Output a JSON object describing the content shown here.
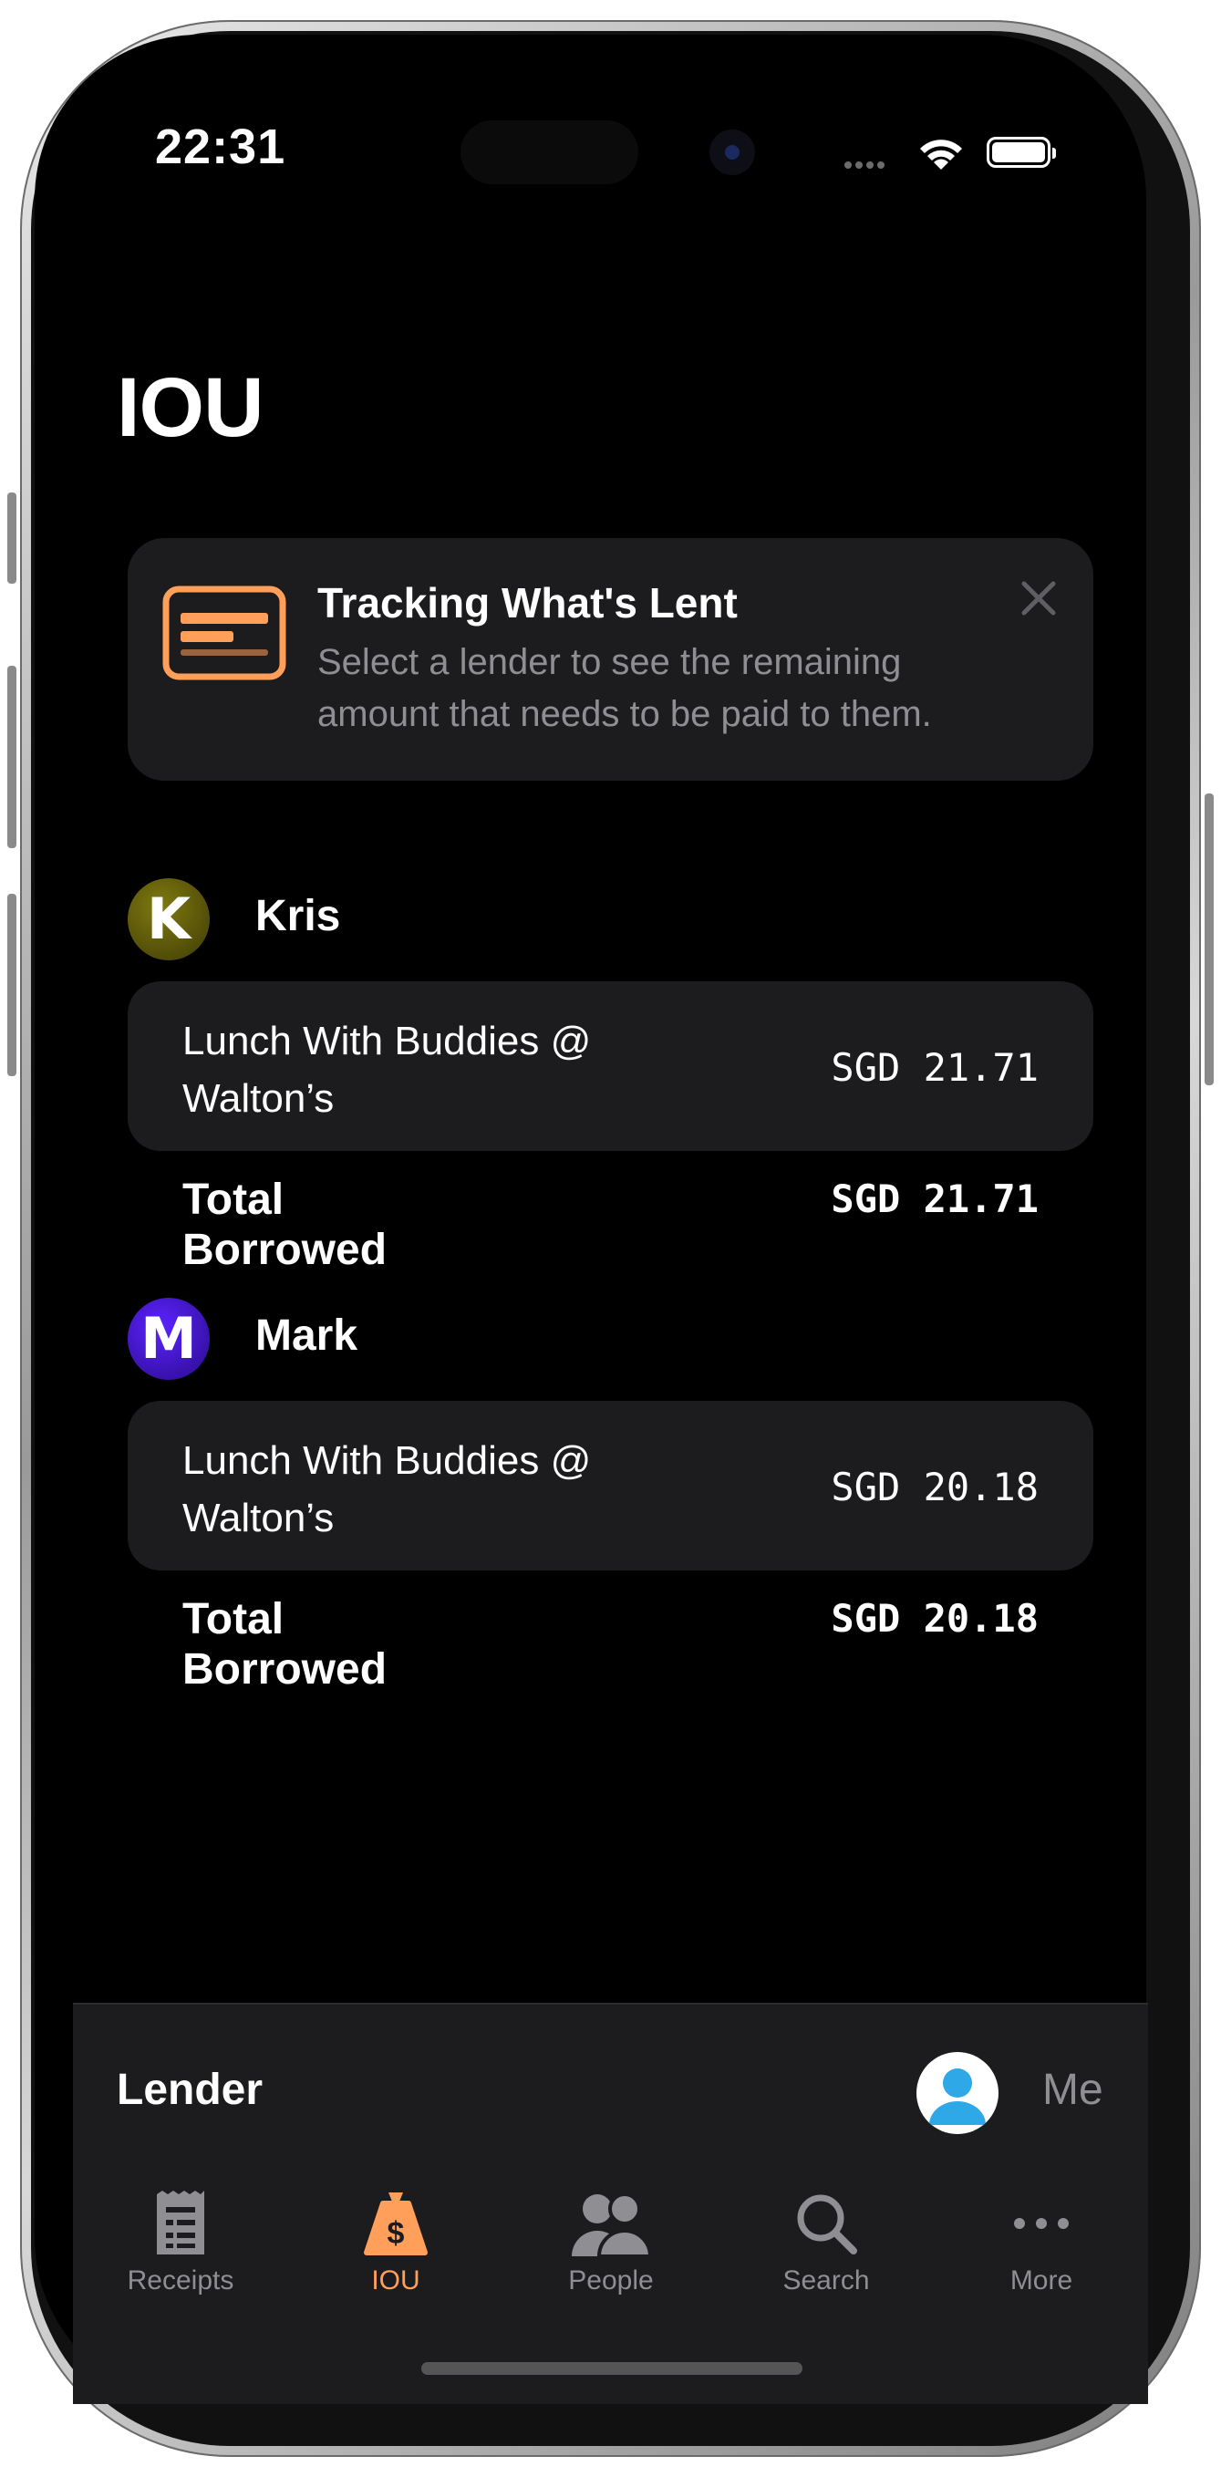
{
  "status_bar": {
    "time": "22:31"
  },
  "header": {
    "title": "IOU"
  },
  "tip": {
    "title": "Tracking What's Lent",
    "body": "Select a lender to see the remaining amount that needs to be paid to them."
  },
  "lenders": [
    {
      "initial": "K",
      "name": "Kris",
      "item_name": "Lunch With Buddies @ Walton’s",
      "item_amount": "SGD 21.71",
      "total_label": "Total Borrowed",
      "total_amount": "SGD 21.71"
    },
    {
      "initial": "M",
      "name": "Mark",
      "item_name": "Lunch With Buddies @ Walton’s",
      "item_amount": "SGD 20.18",
      "total_label": "Total Borrowed",
      "total_amount": "SGD 20.18"
    }
  ],
  "lender_bar": {
    "label": "Lender",
    "selected": "Me"
  },
  "tabs": [
    {
      "label": "Receipts",
      "icon": "receipt-icon",
      "active": false
    },
    {
      "label": "IOU",
      "icon": "money-bag-icon",
      "active": true
    },
    {
      "label": "People",
      "icon": "people-icon",
      "active": false
    },
    {
      "label": "Search",
      "icon": "search-icon",
      "active": false
    },
    {
      "label": "More",
      "icon": "more-icon",
      "active": false
    }
  ],
  "colors": {
    "accent": "#ff9f5a",
    "card": "#1c1c1e",
    "secondary_text": "#8e8e93",
    "background": "#000000"
  }
}
